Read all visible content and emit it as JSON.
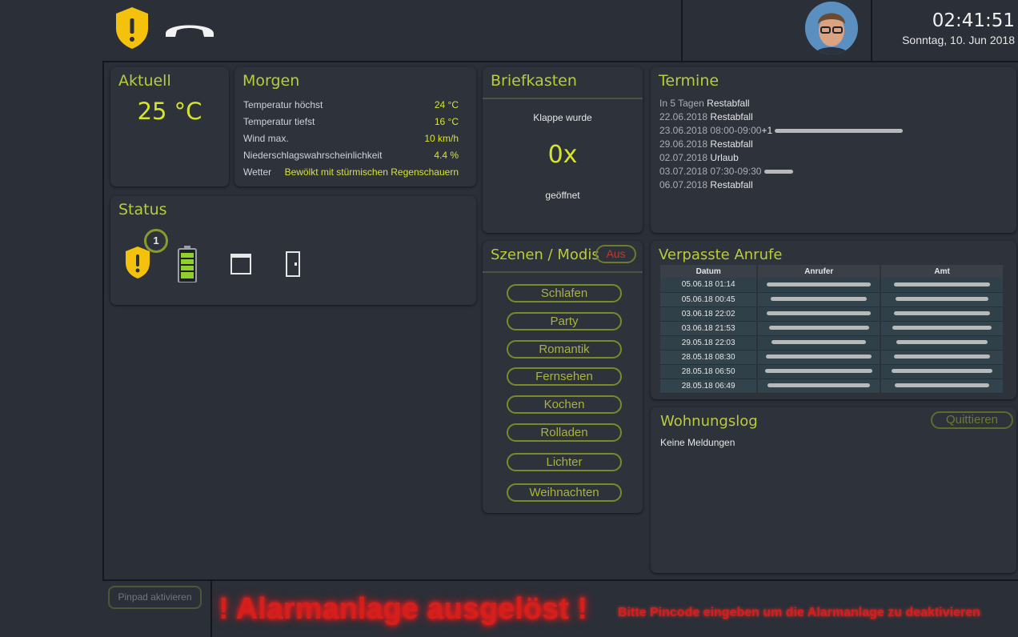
{
  "header": {
    "time": "02:41:51",
    "date": "Sonntag, 10. Jun 2018"
  },
  "aktuell": {
    "title": "Aktuell",
    "temperature": "25 °C"
  },
  "morgen": {
    "title": "Morgen",
    "rows": [
      {
        "label": "Temperatur höchst",
        "value": "24 °C"
      },
      {
        "label": "Temperatur tiefst",
        "value": "16 °C"
      },
      {
        "label": "Wind max.",
        "value": "10 km/h"
      },
      {
        "label": "Niederschlagswahrscheinlichkeit",
        "value": "4.4 %"
      },
      {
        "label": "Wetter",
        "value": "Bewölkt mit stürmischen Regenschauern"
      }
    ]
  },
  "briefkasten": {
    "title": "Briefkasten",
    "line1": "Klappe wurde",
    "count": "0x",
    "line2": "geöffnet"
  },
  "termine": {
    "title": "Termine",
    "items": [
      {
        "date": "In 5 Tagen",
        "text": "Restabfall"
      },
      {
        "date": "22.06.2018",
        "text": "Restabfall"
      },
      {
        "date": "23.06.2018 08:00-09:00",
        "text": "+1"
      },
      {
        "date": "29.06.2018",
        "text": "Restabfall"
      },
      {
        "date": "02.07.2018",
        "text": "Urlaub"
      },
      {
        "date": "03.07.2018 07:30-09:30",
        "text": ""
      },
      {
        "date": "06.07.2018",
        "text": "Restabfall"
      }
    ]
  },
  "status": {
    "title": "Status",
    "badge": "1"
  },
  "szenen": {
    "title": "Szenen / Modis",
    "off_label": "Aus",
    "buttons": [
      "Schlafen",
      "Party",
      "Romantik",
      "Fernsehen",
      "Kochen",
      "Rolladen",
      "Lichter",
      "Weihnachten"
    ]
  },
  "anrufe": {
    "title": "Verpasste Anrufe",
    "columns": [
      "Datum",
      "Anrufer",
      "Amt"
    ],
    "rows": [
      "05.06.18 01:14",
      "05.06.18 00:45",
      "03.06.18 22:02",
      "03.06.18 21:53",
      "29.05.18 22:03",
      "28.05.18 08:30",
      "28.05.18 06:50",
      "28.05.18 06:49"
    ]
  },
  "wohnungslog": {
    "title": "Wohnungslog",
    "ack_label": "Quittieren",
    "message": "Keine Meldungen"
  },
  "footer": {
    "pinpad_label": "Pinpad aktivieren",
    "alarm_text": "! Alarmanlage ausgelöst !",
    "alarm_hint": "Bitte Pincode eingeben um die Alarmanlage zu deaktivieren"
  },
  "colors": {
    "accent": "#b8cc3c",
    "value": "#d7e52a",
    "alarm": "#e0201c",
    "shield": "#f4c20d"
  }
}
